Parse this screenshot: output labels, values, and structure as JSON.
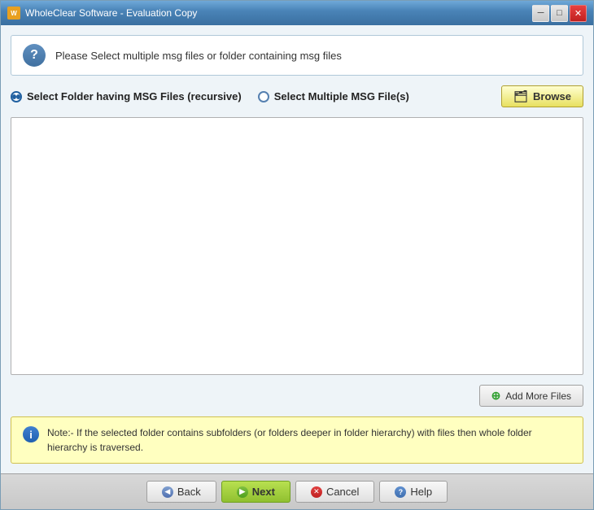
{
  "window": {
    "title": "WholeClear Software - Evaluation Copy",
    "titleIcon": "W"
  },
  "header": {
    "text": "Please Select multiple msg files or folder containing msg files"
  },
  "options": {
    "radio1": {
      "label": "Select Folder having MSG Files (recursive)",
      "checked": true
    },
    "radio2": {
      "label": "Select Multiple MSG File(s)",
      "checked": false
    },
    "browseLabel": "Browse"
  },
  "fileArea": {
    "placeholder": ""
  },
  "addMoreBtn": {
    "label": "Add More Files"
  },
  "note": {
    "text": "Note:- If the selected folder contains subfolders (or folders deeper in folder hierarchy) with files then whole folder hierarchy is traversed."
  },
  "bottomBar": {
    "backLabel": "Back",
    "nextLabel": "Next",
    "cancelLabel": "Cancel",
    "helpLabel": "Help"
  }
}
